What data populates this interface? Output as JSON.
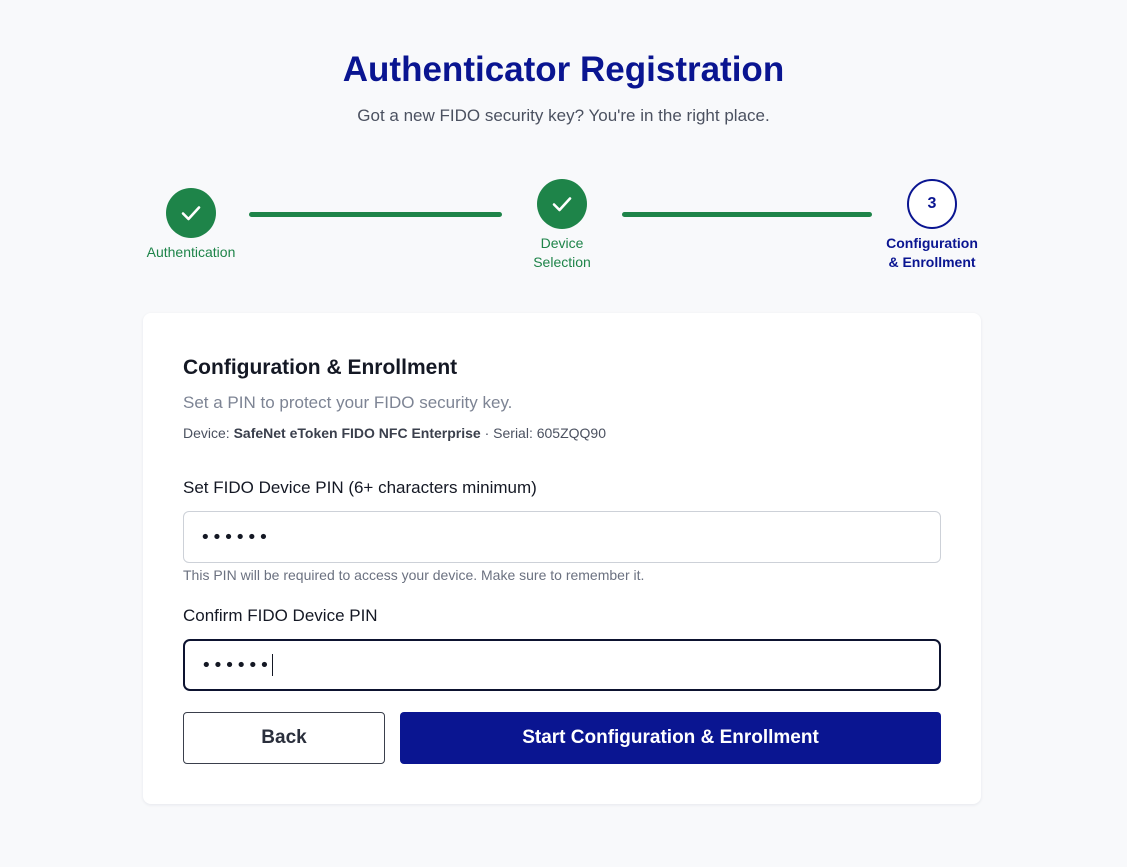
{
  "header": {
    "title": "Authenticator Registration",
    "subtitle": "Got a new FIDO security key? You're in the right place."
  },
  "stepper": {
    "steps": [
      {
        "label": "Authentication",
        "status": "complete",
        "icon": "check-icon"
      },
      {
        "label_line1": "Device",
        "label_line2": "Selection",
        "status": "complete",
        "icon": "check-icon"
      },
      {
        "number": "3",
        "label_line1": "Configuration",
        "label_line2": "& Enrollment",
        "status": "active"
      }
    ]
  },
  "card": {
    "title": "Configuration & Enrollment",
    "subtitle": "Set a PIN to protect your FIDO security key.",
    "device_prefix": "Device:",
    "device_name": "SafeNet eToken FIDO NFC Enterprise",
    "serial_text": "· Serial: 605ZQQ90",
    "pin_field": {
      "label": "Set FIDO Device PIN (6+ characters minimum)",
      "value": "••••••",
      "hint": "This PIN will be required to access your device. Make sure to remember it."
    },
    "confirm_field": {
      "label": "Confirm FIDO Device PIN",
      "value": "••••••",
      "focused": true
    },
    "buttons": {
      "back": "Back",
      "start": "Start Configuration & Enrollment"
    }
  },
  "colors": {
    "brand_navy": "#0a1591",
    "success_green": "#1e8449",
    "background": "#f8f9fb"
  }
}
